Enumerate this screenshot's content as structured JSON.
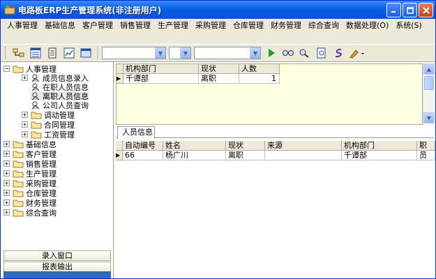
{
  "window": {
    "title": "电路板ERP生产管理系统(非注册用户)"
  },
  "menu": [
    "人事管理",
    "基础信息",
    "客户管理",
    "销售管理",
    "生产管理",
    "采购管理",
    "仓库管理",
    "财务管理",
    "综合查询",
    "数据处理(O)",
    "系统(S)"
  ],
  "toolbar": {
    "combo1_value": "",
    "combo2_value": "",
    "combo3_value": ""
  },
  "tree": {
    "root": "人事管理",
    "children": [
      "成员信息录入",
      "在职人员信息",
      "离职人员信息",
      "公司人员查询"
    ],
    "subfolders": [
      "调动管理",
      "合同管理",
      "工资管理"
    ],
    "top": [
      "基础信息",
      "客户管理",
      "销售管理",
      "生产管理",
      "采购管理",
      "仓库管理",
      "财务管理",
      "综合查询"
    ]
  },
  "sidebar_buttons": {
    "input_window": "录入窗口",
    "report_output": "报表输出"
  },
  "summary_grid": {
    "columns": [
      "机构部门",
      "现状",
      "人数"
    ],
    "rows": [
      [
        "千谭部",
        "离职",
        "1"
      ]
    ]
  },
  "tab": {
    "label": "人员信息"
  },
  "detail_grid": {
    "columns": [
      "自动编号",
      "姓名",
      "现状",
      "来源",
      "机构部门",
      "职"
    ],
    "rows": [
      [
        "66",
        "杨广川",
        "离职",
        "",
        "千谭部",
        "员"
      ]
    ]
  },
  "colors": {
    "title_blue": "#0a5fe8",
    "summary_bg": "#ffffe1",
    "selection_blue": "#316ac5"
  }
}
